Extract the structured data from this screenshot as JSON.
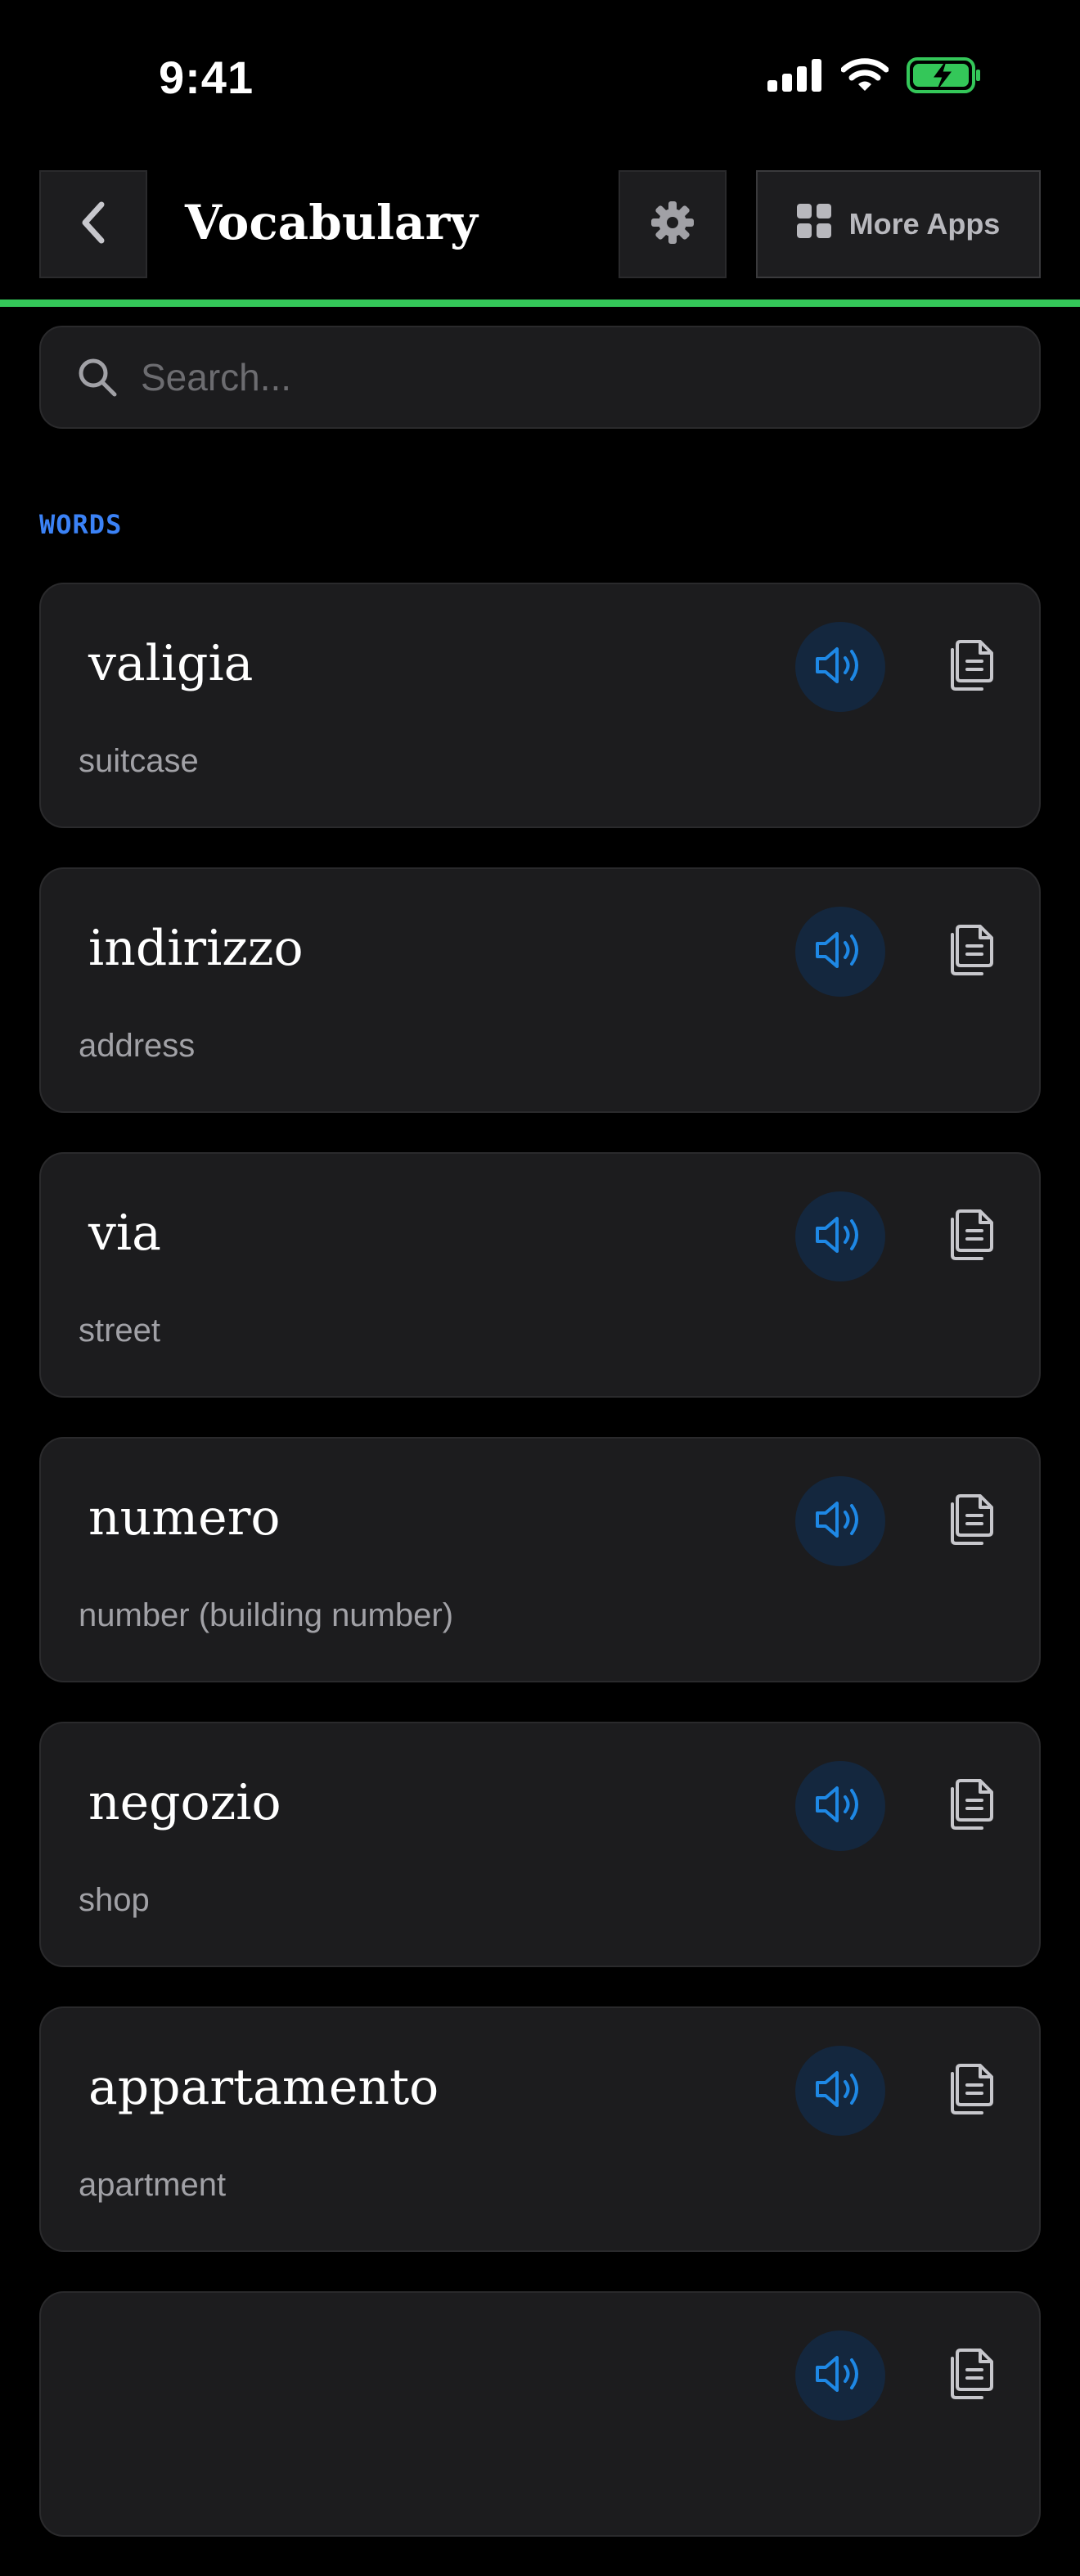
{
  "status": {
    "time": "9:41"
  },
  "nav": {
    "title": "Vocabulary",
    "more_apps_label": "More Apps"
  },
  "search": {
    "placeholder": "Search..."
  },
  "section": {
    "label": "WORDS"
  },
  "words": [
    {
      "word": "valigia",
      "translation": "suitcase"
    },
    {
      "word": "indirizzo",
      "translation": "address"
    },
    {
      "word": "via",
      "translation": "street"
    },
    {
      "word": "numero",
      "translation": "number (building number)"
    },
    {
      "word": "negozio",
      "translation": "shop"
    },
    {
      "word": "appartamento",
      "translation": "apartment"
    },
    {
      "word": "",
      "translation": ""
    }
  ],
  "colors": {
    "accent_green": "#34c759",
    "accent_blue": "#3b82f6",
    "background": "#000000",
    "card": "#1c1c1e"
  },
  "icons": [
    "back-chevron",
    "gear",
    "grid",
    "search",
    "speaker",
    "copy",
    "signal",
    "wifi",
    "battery-charging"
  ]
}
